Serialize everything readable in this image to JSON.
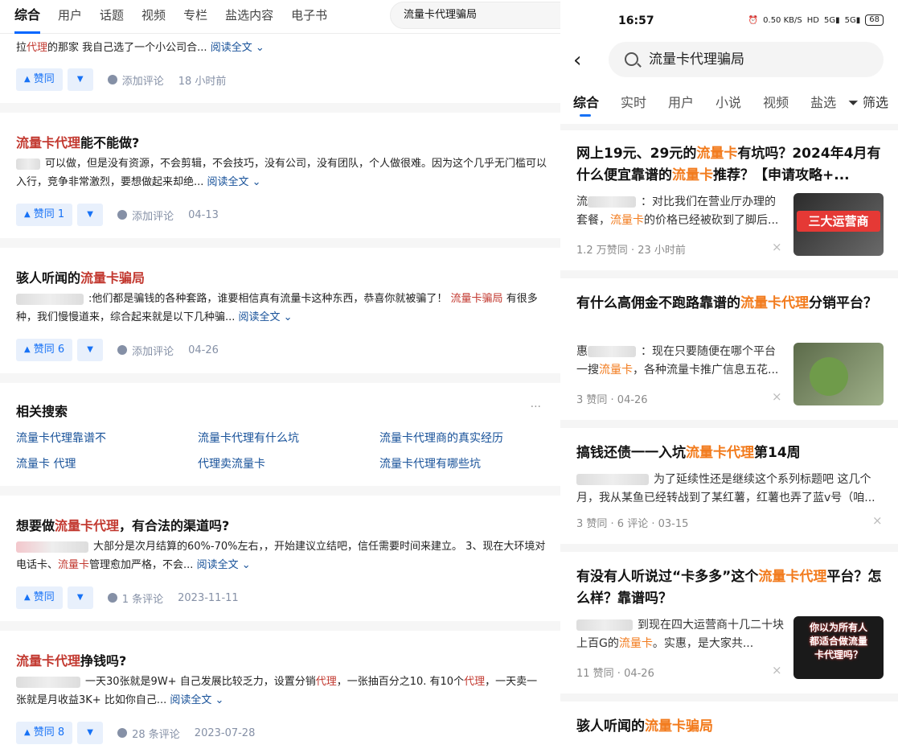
{
  "left": {
    "tabs": [
      "综合",
      "用户",
      "话题",
      "视频",
      "专栏",
      "盐选内容",
      "电子书"
    ],
    "search_query": "流量卡代理骗局",
    "card0": {
      "excerpt_pre": "拉",
      "excerpt_hl": "代理",
      "excerpt_post": "的那家 我自己选了一个小公司合...",
      "read_more": "阅读全文 ⌄",
      "vote": "赞同",
      "comment": "添加评论",
      "time": "18 小时前"
    },
    "card1": {
      "title_hl": "流量卡代理",
      "title_rest": "能不能做?",
      "excerpt": "可以做，但是没有资源，不会剪辑，不会技巧，没有公司，没有团队，个人做很难。因为这个几乎无门槛可以入行，竞争非常激烈，要想做起来却绝...",
      "read_more": "阅读全文 ⌄",
      "vote": "赞同 1",
      "comment": "添加评论",
      "time": "04-13"
    },
    "card2": {
      "title_pre": "骇人听闻的",
      "title_hl": "流量卡骗局",
      "excerpt_pre": ":他们都是骗钱的各种套路，谁要相信真有流量卡这种东西，恭喜你就被骗了！",
      "excerpt_hl": "流量卡骗局",
      "excerpt_post": "有很多种，我们慢慢道来，综合起来就是以下几种骗...",
      "read_more": "阅读全文 ⌄",
      "vote": "赞同 6",
      "comment": "添加评论",
      "time": "04-26"
    },
    "related": {
      "title": "相关搜索",
      "more": "···",
      "items": [
        "流量卡代理靠谱不",
        "流量卡代理有什么坑",
        "流量卡代理商的真实经历",
        "流量卡 代理",
        "代理卖流量卡",
        "流量卡代理有哪些坑"
      ]
    },
    "card3": {
      "title_pre": "想要做",
      "title_hl": "流量卡代理",
      "title_rest": "，有合法的渠道吗?",
      "excerpt_a": "大部分是次月结算的60%-70%左右，，开始建议立结吧，信任需要时间来建立。 3、现在大环境对电话卡、",
      "excerpt_hl": "流量卡",
      "excerpt_b": "管理愈加严格，不会...",
      "read_more": "阅读全文 ⌄",
      "vote": "赞同",
      "comment": "1 条评论",
      "time": "2023-11-11"
    },
    "card4": {
      "title_hl": "流量卡代理",
      "title_rest": "挣钱吗?",
      "excerpt_a": "一天30张就是9W+ 自己发展比较乏力，设置分销",
      "excerpt_hl1": "代理",
      "excerpt_b": "，一张抽百分之10. 有10个",
      "excerpt_hl2": "代理",
      "excerpt_c": "，一天卖一张就是月收益3K+ 比如你自己...",
      "read_more": "阅读全文 ⌄",
      "vote": "赞同 8",
      "comment": "28 条评论",
      "time": "2023-07-28"
    }
  },
  "right": {
    "status": {
      "time": "16:57",
      "speed": "0.50 KB/S",
      "hd": "HD",
      "net1": "5G",
      "net2": "5G",
      "battery": "68"
    },
    "search_query": "流量卡代理骗局",
    "tabs": [
      "综合",
      "实时",
      "用户",
      "小说",
      "视频",
      "盐选"
    ],
    "filter": "筛选",
    "cards": [
      {
        "title_a": "网上19元、29元的",
        "title_hl": "流量卡",
        "title_b": "有坑吗？2024年4月有什么便宜靠谱的",
        "title_hl2": "流量卡",
        "title_c": "推荐？【申请攻略+...",
        "ex_a": "流",
        "ex_b": "：对比我们在营业厅办理的套餐，",
        "ex_hl": "流量卡",
        "ex_c": "的价格已经被砍到了脚后...",
        "meta": "1.2 万赞同 · 23 小时前",
        "thumb_text": "三大运营商"
      },
      {
        "title_a": "有什么高佣金不跑路靠谱的",
        "title_hl": "流量卡代理",
        "title_b": "分销平台？",
        "ex_a": "惠",
        "ex_b": "：现在只要随便在哪个平台一搜",
        "ex_hl": "流量卡",
        "ex_c": "，各种流量卡推广信息五花...",
        "meta": "3 赞同 · 04-26"
      },
      {
        "title_a": "搞钱还债一一入坑",
        "title_hl": "流量卡代理",
        "title_b": "第14周",
        "ex": "为了延续性还是继续这个系列标题吧 这几个月，我从某鱼已经转战到了某红薯，红薯也弄了蓝v号（咱...",
        "meta": "3 赞同 · 6 评论 · 03-15"
      },
      {
        "title_a": "有没有人听说过“卡多多”这个",
        "title_hl": "流量卡代理",
        "title_b": "平台？怎么样？靠谱吗？",
        "ex_b": "到现在四大运营商十几二十块上百G的",
        "ex_hl": "流量卡",
        "ex_c": "。实惠，是大家共...",
        "meta": "11 赞同 · 04-26",
        "thumb_text": "你以为所有人都适合做流量卡代理吗？"
      },
      {
        "title_a": "骇人听闻的",
        "title_hl": "流量卡骗局"
      }
    ],
    "close": "×"
  }
}
